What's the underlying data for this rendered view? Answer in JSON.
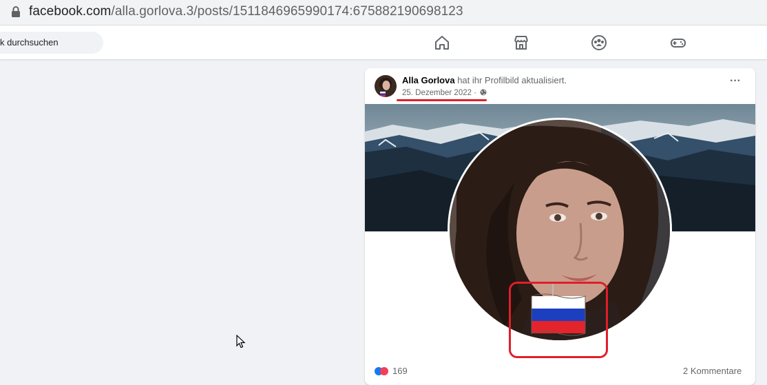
{
  "browser": {
    "url_domain": "facebook.com",
    "url_path": "/alla.gorlova.3/posts/1511846965990174:675882190698123"
  },
  "nav": {
    "search_text": "k durchsuchen",
    "icons": [
      "home-icon",
      "marketplace-icon",
      "groups-icon",
      "gaming-icon"
    ]
  },
  "post": {
    "author": "Alla Gorlova",
    "action": " hat ihr Profilbild aktualisiert.",
    "date": "25. Dezember 2022",
    "date_separator": " · ",
    "more_label": "···",
    "reaction_count": "169",
    "comments_label": "2 Kommentare"
  },
  "colors": {
    "annotation_red": "#e01e2a",
    "flag": [
      "#ffffff",
      "#1c3fbf",
      "#e3242b"
    ]
  }
}
